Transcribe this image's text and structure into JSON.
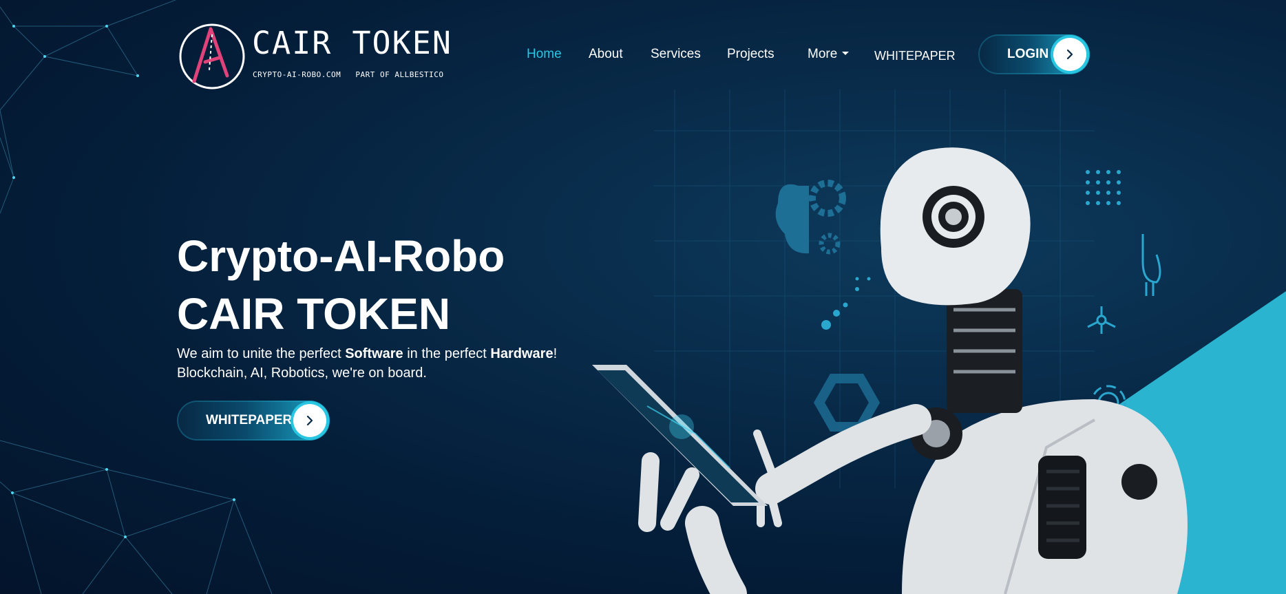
{
  "logo": {
    "title": "CAIR TOKEN",
    "sub_left": "CRYPTO-AI-ROBO.COM",
    "sub_right": "PART OF ALLBESTICO"
  },
  "nav": {
    "items": [
      {
        "label": "Home",
        "active": true
      },
      {
        "label": "About"
      },
      {
        "label": "Services"
      },
      {
        "label": "Projects"
      },
      {
        "label": "More",
        "dropdown": true
      },
      {
        "label": "WHITEPAPER"
      }
    ],
    "login_label": "LOGIN"
  },
  "hero": {
    "title_line1": "Crypto-AI-Robo",
    "title_line2": "CAIR TOKEN",
    "tagline_pre": "We aim to unite the perfect ",
    "tagline_bold1": "Software",
    "tagline_mid": " in the perfect ",
    "tagline_bold2": "Hardware",
    "tagline_end": "!",
    "tagline_line2": "Blockchain, AI, Robotics, we're on board.",
    "button_label": "WHITEPAPER"
  },
  "icons": {
    "arrow": "chevron-right-icon",
    "robot": "robot-illustration",
    "brain": "brain-gear-icon"
  },
  "colors": {
    "accent": "#27c8e3",
    "logo_pink": "#e0427a",
    "background": "#041d38",
    "wedge": "#2ab4cf"
  }
}
